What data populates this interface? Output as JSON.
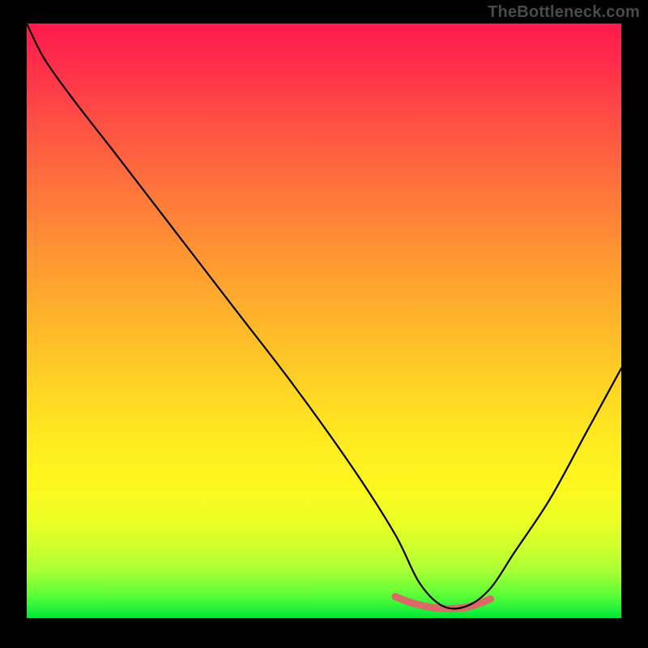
{
  "watermark": "TheBottleneck.com",
  "chart_data": {
    "type": "line",
    "title": "",
    "xlabel": "",
    "ylabel": "",
    "xlim": [
      0,
      100
    ],
    "ylim": [
      0,
      100
    ],
    "grid": false,
    "description": "Bottleneck curve over a red-to-green vertical gradient background. The black line starts near the top-left, descends roughly linearly toward a minimum near x≈70, then rises again. A short coral-colored thick segment sits at the valley floor.",
    "gradient_stops": [
      {
        "pos": 0,
        "color": "#ff1a4d"
      },
      {
        "pos": 7,
        "color": "#ff2e4a"
      },
      {
        "pos": 14,
        "color": "#ff4746"
      },
      {
        "pos": 22,
        "color": "#ff6140"
      },
      {
        "pos": 30,
        "color": "#ff7b3a"
      },
      {
        "pos": 38,
        "color": "#ff9333"
      },
      {
        "pos": 46,
        "color": "#ffaa2e"
      },
      {
        "pos": 54,
        "color": "#ffc028"
      },
      {
        "pos": 62,
        "color": "#ffd624"
      },
      {
        "pos": 70,
        "color": "#ffea20"
      },
      {
        "pos": 78,
        "color": "#fdf81f"
      },
      {
        "pos": 84,
        "color": "#eaff25"
      },
      {
        "pos": 88,
        "color": "#cfff2d"
      },
      {
        "pos": 92,
        "color": "#aaff34"
      },
      {
        "pos": 96,
        "color": "#5fff38"
      },
      {
        "pos": 100,
        "color": "#00e83a"
      }
    ],
    "series": [
      {
        "name": "bottleneck-black",
        "color": "#000000",
        "x": [
          0,
          3,
          8,
          15,
          25,
          35,
          45,
          55,
          62,
          66,
          70,
          74,
          78,
          82,
          88,
          94,
          100
        ],
        "y": [
          100,
          94,
          87,
          78,
          65,
          52,
          39,
          25,
          14,
          6,
          2,
          2,
          5,
          11,
          20,
          31,
          42
        ]
      },
      {
        "name": "valley-highlight-coral",
        "color": "#d96a65",
        "x": [
          62,
          64,
          66,
          68,
          70,
          72,
          74,
          76,
          78
        ],
        "y": [
          3.6,
          2.8,
          2.2,
          1.8,
          1.6,
          1.6,
          1.8,
          2.4,
          3.2
        ]
      }
    ]
  }
}
